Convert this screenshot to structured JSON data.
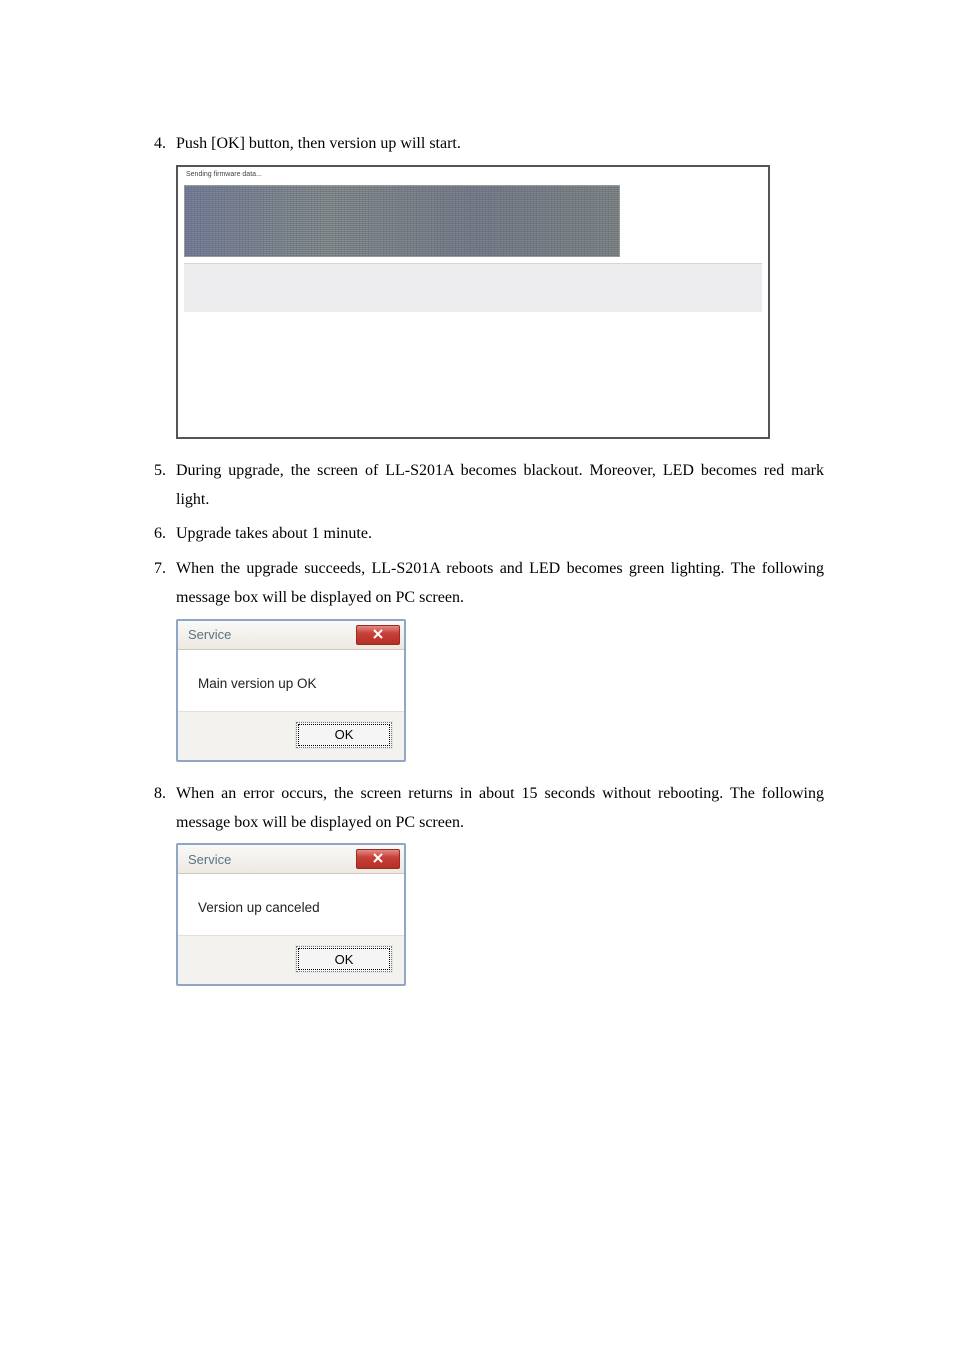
{
  "steps": {
    "s4": {
      "num": "4.",
      "text": "Push [OK] button, then version up will start."
    },
    "s5": {
      "num": "5.",
      "text": "During upgrade, the screen of LL-S201A becomes blackout. Moreover, LED becomes red mark light."
    },
    "s6": {
      "num": "6.",
      "text": "Upgrade takes about 1 minute."
    },
    "s7": {
      "num": "7.",
      "text": "When the upgrade succeeds, LL-S201A reboots and LED becomes green lighting. The following message box will be displayed on PC screen."
    },
    "s8": {
      "num": "8.",
      "text": "When an error occurs, the screen returns in about 15 seconds without rebooting. The following message box will be displayed on PC screen."
    }
  },
  "figure": {
    "caption": "Sending firmware data..."
  },
  "dialog_ok": {
    "title": "Service",
    "message": "Main version up OK",
    "button": "OK"
  },
  "dialog_cancel": {
    "title": "Service",
    "message": "Version up canceled",
    "button": "OK"
  }
}
